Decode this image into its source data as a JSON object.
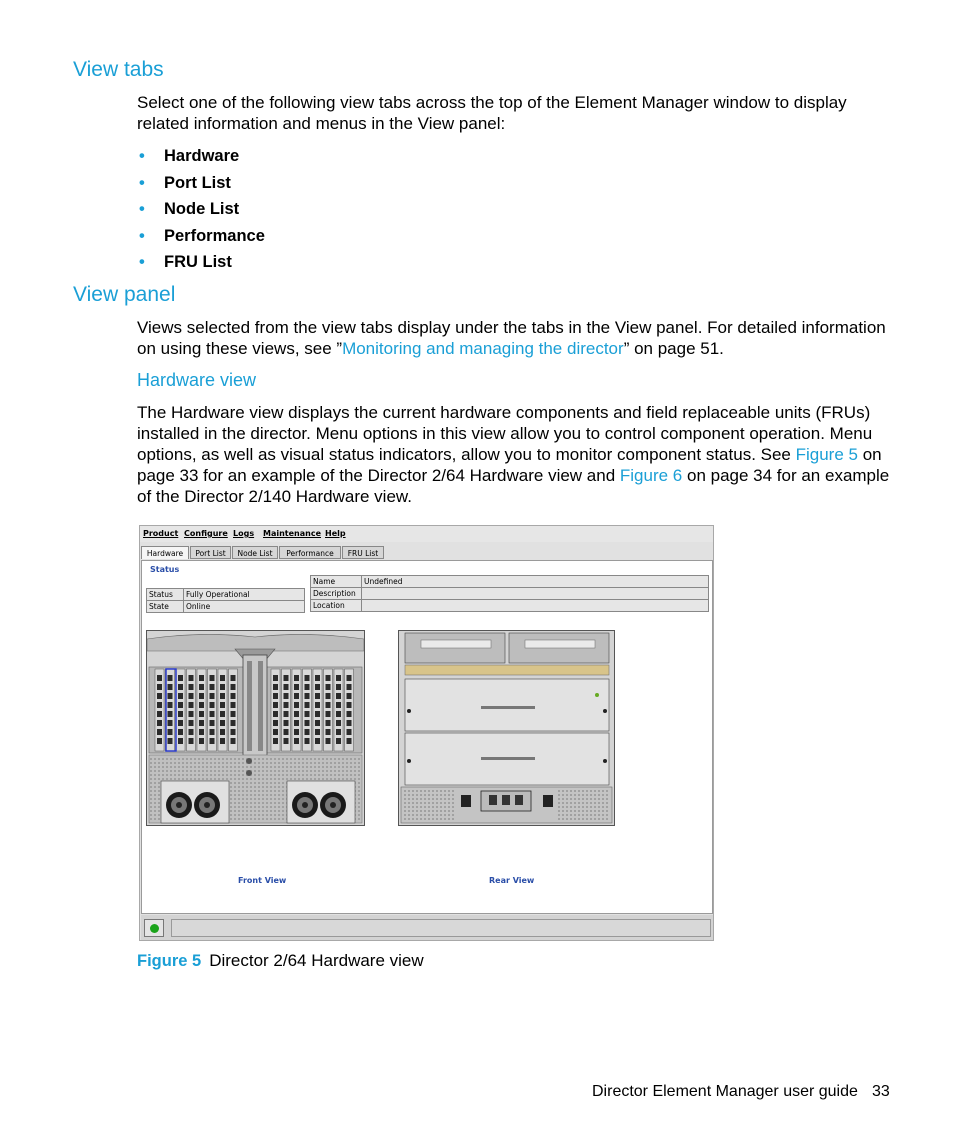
{
  "sections": {
    "view_tabs": {
      "heading": "View tabs",
      "intro": "Select one of the following view tabs across the top of the Element Manager window to display related information and menus in the View panel:",
      "bullets": [
        "Hardware",
        "Port List",
        "Node List",
        "Performance",
        "FRU List"
      ]
    },
    "view_panel": {
      "heading": "View panel",
      "para_before": "Views selected from the view tabs display under the tabs in the View panel. For detailed information on using these views, see ”",
      "para_link": "Monitoring and managing the director",
      "para_after": "” on page 51."
    },
    "hardware_view": {
      "heading": "Hardware view",
      "p1": "The Hardware view displays the current hardware components and field replaceable units (FRUs) installed in the director. Menu options in this view allow you to control component operation. Menu options, as well as visual status indicators, allow you to monitor component status. See ",
      "p1_link1": "Figure 5",
      "p1_mid": " on page 33 for an example of the Director 2/64 Hardware view and ",
      "p1_link2": "Figure 6",
      "p1_end": " on page 34 for an example of the Director 2/140 Hardware view."
    }
  },
  "screenshot": {
    "menu": [
      "Product",
      "Configure",
      "Logs",
      "Maintenance",
      "Help"
    ],
    "tabs": [
      "Hardware",
      "Port List",
      "Node List",
      "Performance",
      "FRU List"
    ],
    "active_tab": "Hardware",
    "status_label": "Status",
    "left_table": [
      [
        "Status",
        "Fully Operational"
      ],
      [
        "State",
        "Online"
      ]
    ],
    "right_table": [
      [
        "Name",
        "Undefined"
      ],
      [
        "Description",
        ""
      ],
      [
        "Location",
        ""
      ]
    ],
    "front_caption": "Front View",
    "rear_caption": "Rear View",
    "status_led_color": "#1aa31a"
  },
  "figure": {
    "label": "Figure 5",
    "caption": "Director 2/64 Hardware view"
  },
  "footer": {
    "title": "Director Element Manager user guide",
    "page": "33"
  },
  "colors": {
    "accent": "#1a9fd6"
  }
}
